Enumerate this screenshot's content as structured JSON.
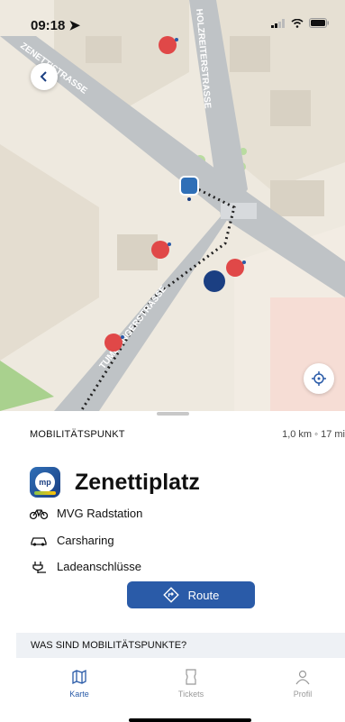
{
  "status": {
    "time": "09:18"
  },
  "map": {
    "streets": [
      "ZENETTISTRASSE",
      "HOLZREITERSTRASSE",
      "TUMBLINGERSTRASSE"
    ]
  },
  "sheet": {
    "header": "MOBILITÄTSPUNKT",
    "distance": "1,0 km ◦ 17 mi",
    "place_name": "Zenettiplatz",
    "logo_text": "mp",
    "features": [
      {
        "icon": "bicycle-icon",
        "label": "MVG Radstation"
      },
      {
        "icon": "car-icon",
        "label": "Carsharing"
      },
      {
        "icon": "plug-icon",
        "label": "Ladeanschlüsse"
      }
    ],
    "route_label": "Route",
    "info_band": "WAS SIND MOBILITÄTSPUNKTE?"
  },
  "tabs": [
    {
      "label": "Karte",
      "active": true,
      "icon": "map-icon"
    },
    {
      "label": "Tickets",
      "active": false,
      "icon": "ticket-icon"
    },
    {
      "label": "Profil",
      "active": false,
      "icon": "profile-icon"
    }
  ],
  "colors": {
    "accent": "#2a5ba8",
    "scooter": "#e04848",
    "mp_logo": "#1b3f82"
  }
}
